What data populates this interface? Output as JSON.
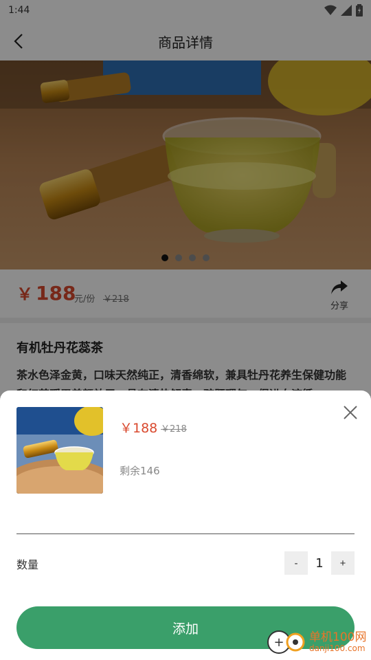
{
  "status_bar": {
    "time": "1:44",
    "icons": [
      "wifi-icon",
      "signal-icon",
      "battery-icon"
    ]
  },
  "header": {
    "title": "商品详情",
    "back_icon": "chevron-left-icon"
  },
  "gallery": {
    "image_count": 4,
    "active_index": 0
  },
  "price": {
    "currency": "￥",
    "amount": "188",
    "unit": "元/份",
    "original": "￥218"
  },
  "share": {
    "label": "分享",
    "icon": "share-icon"
  },
  "product": {
    "title": "有机牡丹花蕊茶",
    "description": "茶水色泽金黄，口味天然纯正，清香绵软，兼具牡丹花养生保健功能和红茶暖胃养颜效用，具有清热解毒，疏肝理气，促进血液循…"
  },
  "sheet": {
    "price": "￥188",
    "original_price": "￥218",
    "stock": "剩余146",
    "quantity_label": "数量",
    "minus": "-",
    "quantity": "1",
    "plus": "+",
    "add_button": "添加",
    "close_icon": "close-icon"
  },
  "watermark": {
    "name": "单机100网",
    "domain": "danji100.com"
  },
  "colors": {
    "accent": "#3a9f6a",
    "price": "#d9492e"
  }
}
